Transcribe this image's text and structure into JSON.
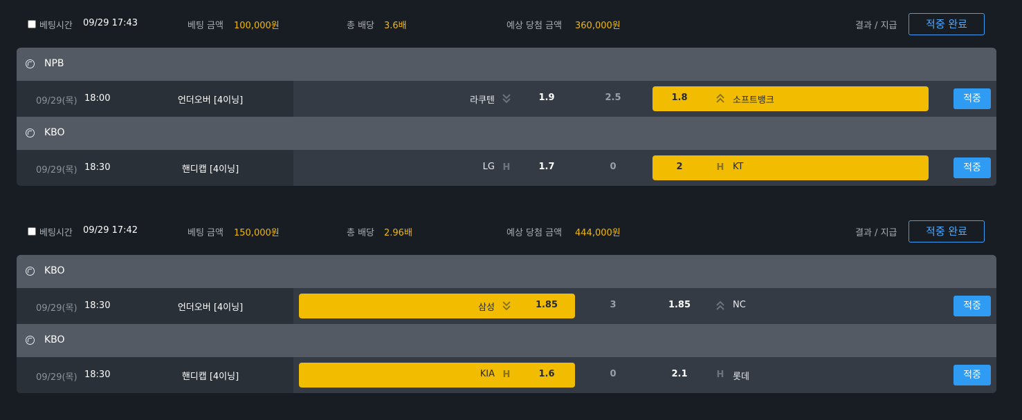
{
  "bets": [
    {
      "bet_time_label": "베팅시간",
      "bet_time": "09/29 17:43",
      "amount_label": "베팅 금액",
      "amount": "100,000원",
      "total_odds_label": "총 배당",
      "total_odds": "3.6배",
      "expected_label": "예상 당첨 금액",
      "expected": "360,000원",
      "result_label": "결과 / 지급",
      "status_button": "적중 완료",
      "games": [
        {
          "league": "NPB",
          "date": "09/29(목)",
          "time": "18:00",
          "market": "언더오버 [4이닝]",
          "home_team": "라쿠텐",
          "home_icon": "under-icon",
          "home_odds": "1.9",
          "line": "2.5",
          "away_odds": "1.8",
          "away_icon": "over-icon",
          "away_team": "소프트뱅크",
          "selected": "away",
          "result": "적중"
        },
        {
          "league": "KBO",
          "date": "09/29(목)",
          "time": "18:30",
          "market": "핸디캡 [4이닝]",
          "home_team": "LG",
          "home_icon": "handicap-icon",
          "home_odds": "1.7",
          "line": "0",
          "away_odds": "2",
          "away_icon": "handicap-icon",
          "away_team": "KT",
          "selected": "away",
          "result": "적중"
        }
      ]
    },
    {
      "bet_time_label": "베팅시간",
      "bet_time": "09/29 17:42",
      "amount_label": "베팅 금액",
      "amount": "150,000원",
      "total_odds_label": "총 배당",
      "total_odds": "2.96배",
      "expected_label": "예상 당첨 금액",
      "expected": "444,000원",
      "result_label": "결과 / 지급",
      "status_button": "적중 완료",
      "games": [
        {
          "league": "KBO",
          "date": "09/29(목)",
          "time": "18:30",
          "market": "언더오버 [4이닝]",
          "home_team": "삼성",
          "home_icon": "under-icon",
          "home_odds": "1.85",
          "line": "3",
          "away_odds": "1.85",
          "away_icon": "over-icon",
          "away_team": "NC",
          "selected": "home",
          "result": "적중"
        },
        {
          "league": "KBO",
          "date": "09/29(목)",
          "time": "18:30",
          "market": "핸디캡 [4이닝]",
          "home_team": "KIA",
          "home_icon": "handicap-icon",
          "home_odds": "1.6",
          "line": "0",
          "away_odds": "2.1",
          "away_icon": "handicap-icon",
          "away_team": "롯데",
          "selected": "home",
          "result": "적중"
        }
      ]
    }
  ],
  "handicap_glyph": "H",
  "colors": {
    "background": "#181d24",
    "accent_gold": "#f2bd00",
    "accent_blue": "#2f9bf3",
    "league_bar": "#535a63"
  }
}
